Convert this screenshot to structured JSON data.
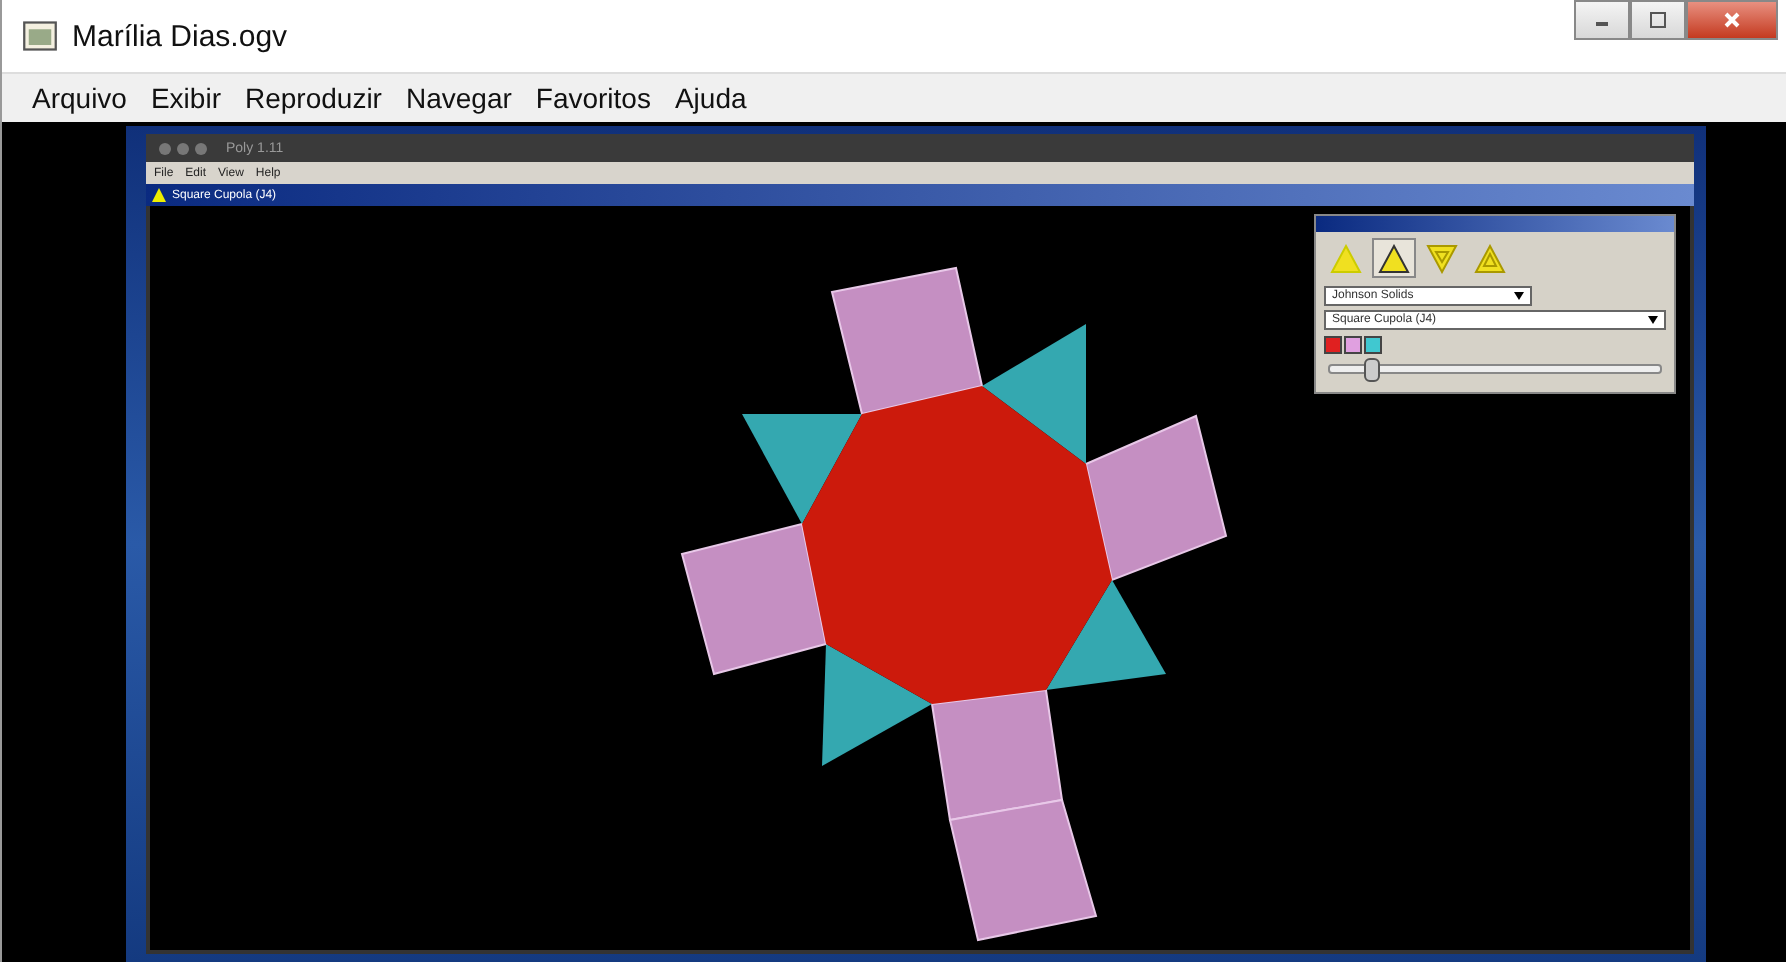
{
  "window": {
    "title": "Marília Dias.ogv"
  },
  "menu": [
    "Arquivo",
    "Exibir",
    "Reproduzir",
    "Navegar",
    "Favoritos",
    "Ajuda"
  ],
  "video": {
    "app": {
      "title": "Poly 1.11",
      "menu": [
        "File",
        "Edit",
        "View",
        "Help"
      ],
      "document_title": "Square Cupola (J4)",
      "panel": {
        "tools": [
          {
            "selected": false
          },
          {
            "selected": true
          },
          {
            "selected": false
          },
          {
            "selected": false
          }
        ],
        "category": "Johnson Solids",
        "solid": "Square Cupola (J4)",
        "swatches": [
          {
            "color": "#e02020"
          },
          {
            "color": "#e0a0e0"
          },
          {
            "color": "#40c8d0"
          }
        ],
        "slider": {
          "level": 0.12
        }
      }
    }
  }
}
